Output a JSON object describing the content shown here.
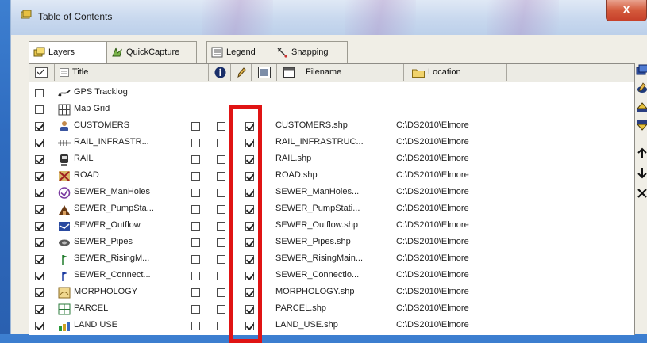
{
  "window": {
    "title": "Table of Contents",
    "close_label": "X"
  },
  "tabs": [
    {
      "label": "Layers",
      "icon": "layers-icon"
    },
    {
      "label": "QuickCapture",
      "icon": "quickcapture-icon"
    },
    {
      "label": "Legend",
      "icon": "legend-icon"
    },
    {
      "label": "Snapping",
      "icon": "snapping-icon"
    }
  ],
  "columns": {
    "title": "Title",
    "filename": "Filename",
    "location": "Location"
  },
  "colors": {
    "highlight": "#e01414",
    "accent": "#2f6cc0"
  },
  "layers": [
    {
      "visible": false,
      "title": "GPS Tracklog",
      "icon": "gps-tracklog-icon",
      "has_options": false
    },
    {
      "visible": false,
      "title": "Map Grid",
      "icon": "map-grid-icon",
      "has_options": false
    },
    {
      "visible": true,
      "title": "CUSTOMERS",
      "icon": "customers-icon",
      "has_options": true,
      "identify": false,
      "editable": false,
      "labels": true,
      "filename": "CUSTOMERS.shp",
      "location": "C:\\DS2010\\Elmore"
    },
    {
      "visible": true,
      "title": "RAIL_INFRASTR...",
      "icon": "rail-infrastructure-icon",
      "has_options": true,
      "identify": false,
      "editable": false,
      "labels": true,
      "filename": "RAIL_INFRASTRUC...",
      "location": "C:\\DS2010\\Elmore"
    },
    {
      "visible": true,
      "title": "RAIL",
      "icon": "rail-icon",
      "has_options": true,
      "identify": false,
      "editable": false,
      "labels": true,
      "filename": "RAIL.shp",
      "location": "C:\\DS2010\\Elmore"
    },
    {
      "visible": true,
      "title": "ROAD",
      "icon": "road-icon",
      "has_options": true,
      "identify": false,
      "editable": false,
      "labels": true,
      "filename": "ROAD.shp",
      "location": "C:\\DS2010\\Elmore"
    },
    {
      "visible": true,
      "title": "SEWER_ManHoles",
      "icon": "sewer-manholes-icon",
      "has_options": true,
      "identify": false,
      "editable": false,
      "labels": true,
      "filename": "SEWER_ManHoles...",
      "location": "C:\\DS2010\\Elmore"
    },
    {
      "visible": true,
      "title": "SEWER_PumpSta...",
      "icon": "sewer-pumpstation-icon",
      "has_options": true,
      "identify": false,
      "editable": false,
      "labels": true,
      "filename": "SEWER_PumpStati...",
      "location": "C:\\DS2010\\Elmore"
    },
    {
      "visible": true,
      "title": "SEWER_Outflow",
      "icon": "sewer-outflow-icon",
      "has_options": true,
      "identify": false,
      "editable": false,
      "labels": true,
      "filename": "SEWER_Outflow.shp",
      "location": "C:\\DS2010\\Elmore"
    },
    {
      "visible": true,
      "title": "SEWER_Pipes",
      "icon": "sewer-pipes-icon",
      "has_options": true,
      "identify": false,
      "editable": false,
      "labels": true,
      "filename": "SEWER_Pipes.shp",
      "location": "C:\\DS2010\\Elmore"
    },
    {
      "visible": true,
      "title": "SEWER_RisingM...",
      "icon": "sewer-risingmain-icon",
      "has_options": true,
      "identify": false,
      "editable": false,
      "labels": true,
      "filename": "SEWER_RisingMain...",
      "location": "C:\\DS2010\\Elmore"
    },
    {
      "visible": true,
      "title": "SEWER_Connect...",
      "icon": "sewer-connection-icon",
      "has_options": true,
      "identify": false,
      "editable": false,
      "labels": true,
      "filename": "SEWER_Connectio...",
      "location": "C:\\DS2010\\Elmore"
    },
    {
      "visible": true,
      "title": "MORPHOLOGY",
      "icon": "morphology-icon",
      "has_options": true,
      "identify": false,
      "editable": false,
      "labels": true,
      "filename": "MORPHOLOGY.shp",
      "location": "C:\\DS2010\\Elmore"
    },
    {
      "visible": true,
      "title": "PARCEL",
      "icon": "parcel-icon",
      "has_options": true,
      "identify": false,
      "editable": false,
      "labels": true,
      "filename": "PARCEL.shp",
      "location": "C:\\DS2010\\Elmore"
    },
    {
      "visible": true,
      "title": "LAND USE",
      "icon": "land-use-icon",
      "has_options": true,
      "identify": false,
      "editable": false,
      "labels": true,
      "filename": "LAND_USE.shp",
      "location": "C:\\DS2010\\Elmore"
    }
  ],
  "tools": [
    {
      "icon": "add-layer-icon"
    },
    {
      "icon": "layer-properties-icon"
    },
    {
      "icon": "move-to-top-icon"
    },
    {
      "icon": "move-to-bottom-icon"
    },
    {
      "icon": "move-up-icon"
    },
    {
      "icon": "move-down-icon"
    },
    {
      "icon": "remove-layer-icon"
    }
  ]
}
